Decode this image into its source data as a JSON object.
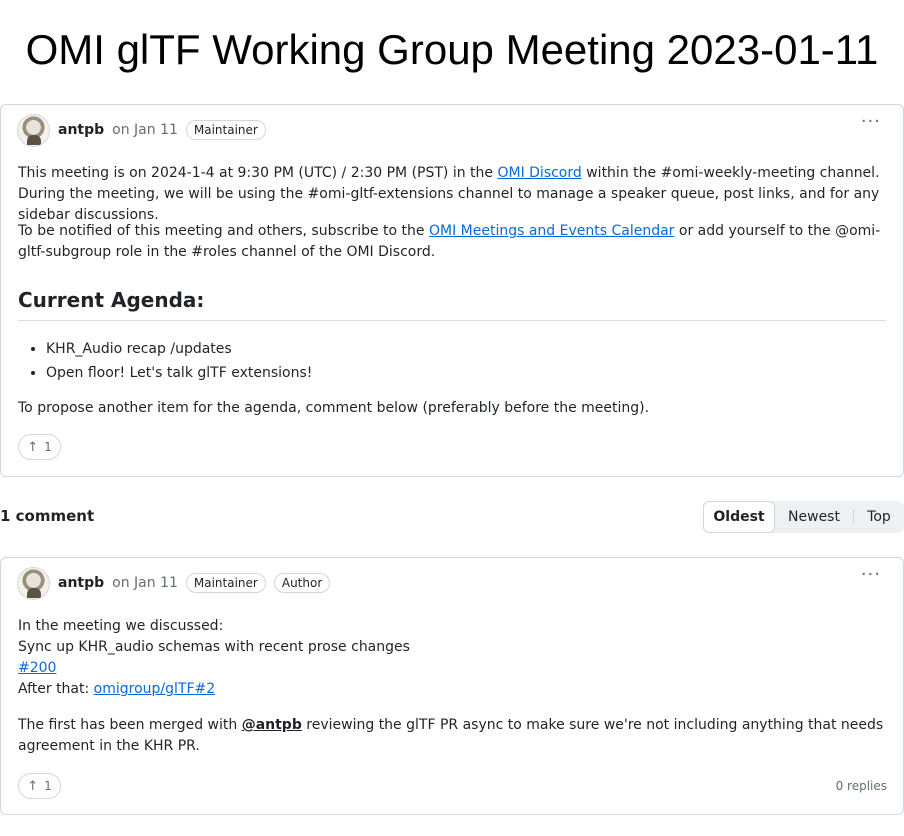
{
  "title": "OMI glTF Working Group Meeting 2023-01-11",
  "post": {
    "author": "antpb",
    "date": "on Jan 11",
    "labels": [
      "Maintainer"
    ],
    "menu_icon": "kebab-horizontal-icon",
    "p1_before": "This meeting is on 2024-1-4 at 9:30 PM (UTC) / 2:30 PM (PST) in the ",
    "p1_link": "OMI Discord",
    "p1_after": " within the #omi-weekly-meeting channel. During the meeting, we will be using the #omi-gltf-extensions channel to manage a speaker queue, post links, and for any sidebar discussions.",
    "p2_before": "To be notified of this meeting and others, subscribe to the ",
    "p2_link": "OMI Meetings and Events Calendar",
    "p2_after": " or add yourself to the @omi-gltf-subgroup role in the #roles channel of the OMI Discord.",
    "agenda_heading": "Current Agenda:",
    "agenda_items": [
      "KHR_Audio recap /updates",
      "Open floor! Let's talk glTF extensions!"
    ],
    "p3": "To propose another item for the agenda, comment below (preferably before the meeting).",
    "reaction_icon": "arrow-up-icon",
    "reaction_count": "1"
  },
  "comments_header": {
    "count_label": "1 comment",
    "sort_options": [
      "Oldest",
      "Newest",
      "Top"
    ],
    "selected": "Oldest"
  },
  "comment": {
    "author": "antpb",
    "date": "on Jan 11",
    "labels": [
      "Maintainer",
      "Author"
    ],
    "line1": "In the meeting we discussed:",
    "line2": "Sync up KHR_audio schemas with recent prose changes",
    "line3_link": "#200",
    "line4_before": "After that: ",
    "line4_link": "omigroup/glTF#2",
    "p2_before": "The first has been merged with ",
    "p2_mention": "@antpb",
    "p2_after": " reviewing the glTF PR async to make sure we're not including anything that needs agreement in the KHR PR.",
    "reaction_count": "1",
    "replies": "0 replies"
  }
}
